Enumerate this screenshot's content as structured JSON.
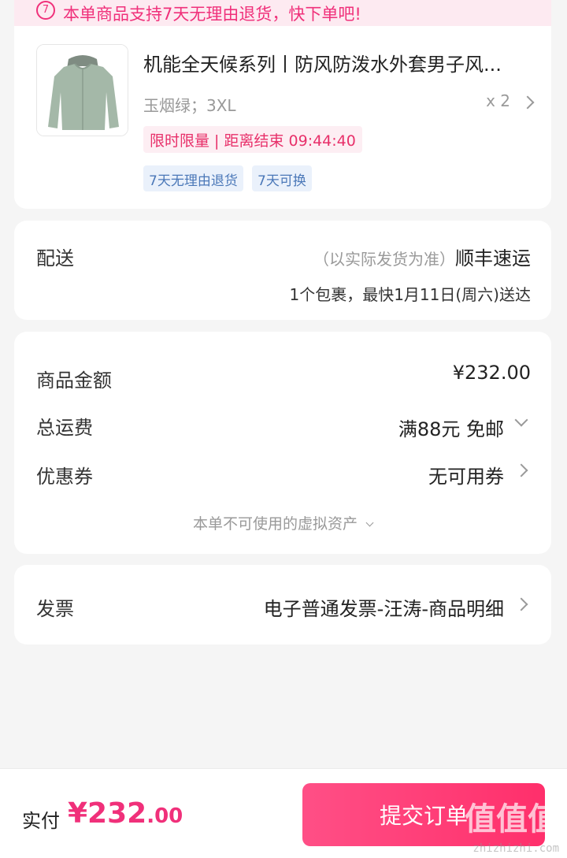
{
  "banner": {
    "text": "本单商品支持7天无理由退货，快下单吧!",
    "icon": "return-7-icon"
  },
  "product": {
    "title": "机能全天候系列丨防风防泼水外套男子风...",
    "variant": "玉烟绿；3XL",
    "quantity": "x 2",
    "promo": "限时限量 | 距离结束 09:44:40",
    "tags": [
      "7天无理由退货",
      "7天可换"
    ]
  },
  "delivery": {
    "label": "配送",
    "note": "（以实际发货为准）",
    "carrier": "顺丰速运",
    "eta": "1个包裹，最快1月11日(周六)送达"
  },
  "costs": {
    "goods_label": "商品金额",
    "goods_value": "¥232.00",
    "shipping_label": "总运费",
    "shipping_value": "满88元 免邮",
    "coupon_label": "优惠券",
    "coupon_value": "无可用券",
    "virtual_note": "本单不可使用的虚拟资产"
  },
  "invoice": {
    "label": "发票",
    "value": "电子普通发票-汪涛-商品明细"
  },
  "footer": {
    "pay_label": "实付",
    "pay_int": "¥232",
    "pay_dec": ".00",
    "submit_label": "提交订单",
    "watermark": "值值值",
    "watermark_url": "zhizhizhi.com"
  },
  "colors": {
    "accent": "#f0307a",
    "tag_bg": "#eaf1fb",
    "tag_text": "#4b78b8"
  }
}
